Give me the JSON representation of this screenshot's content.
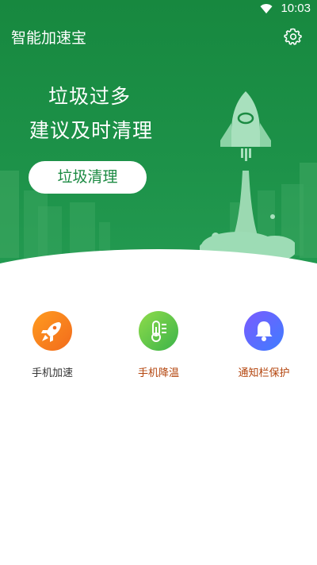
{
  "status": {
    "time": "10:03"
  },
  "appbar": {
    "title": "智能加速宝"
  },
  "hero": {
    "line1": "垃圾过多",
    "line2": "建议及时清理",
    "button": "垃圾清理"
  },
  "features": [
    {
      "label": "手机加速",
      "label_color": "#333333"
    },
    {
      "label": "手机降温",
      "label_color": "#b3440c"
    },
    {
      "label": "通知栏保护",
      "label_color": "#b3440c"
    }
  ],
  "colors": {
    "brand_green": "#1b8a42"
  }
}
